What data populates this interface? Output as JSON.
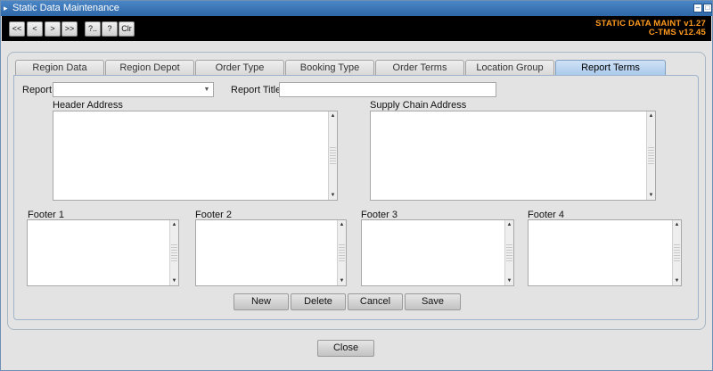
{
  "window": {
    "title": "Static Data Maintenance"
  },
  "toolbar": {
    "buttons": [
      "<<",
      "<",
      ">",
      ">>",
      "?..",
      "?",
      "Clr"
    ],
    "version_line1": "STATIC DATA MAINT v1.27",
    "version_line2": "C-TMS v12.45"
  },
  "tabs": [
    "Region Data",
    "Region Depot",
    "Order Type",
    "Booking Type",
    "Order Terms",
    "Location Group Name",
    "Report Terms Configuration"
  ],
  "active_tab": "Report Terms Configuration",
  "form": {
    "report_label": "Report",
    "report_value": "",
    "report_title_label": "Report Title",
    "report_title_value": "",
    "header_address_label": "Header Address",
    "supply_chain_address_label": "Supply Chain Address",
    "footer1_label": "Footer 1",
    "footer2_label": "Footer 2",
    "footer3_label": "Footer 3",
    "footer4_label": "Footer 4"
  },
  "actions": {
    "new": "New",
    "delete": "Delete",
    "cancel": "Cancel",
    "save": "Save"
  },
  "close_label": "Close",
  "colors": {
    "titlebar": "#2d67a8",
    "toolbar": "#000000",
    "version_text": "#ff9a1f",
    "active_tab": "#a8c8ea"
  }
}
